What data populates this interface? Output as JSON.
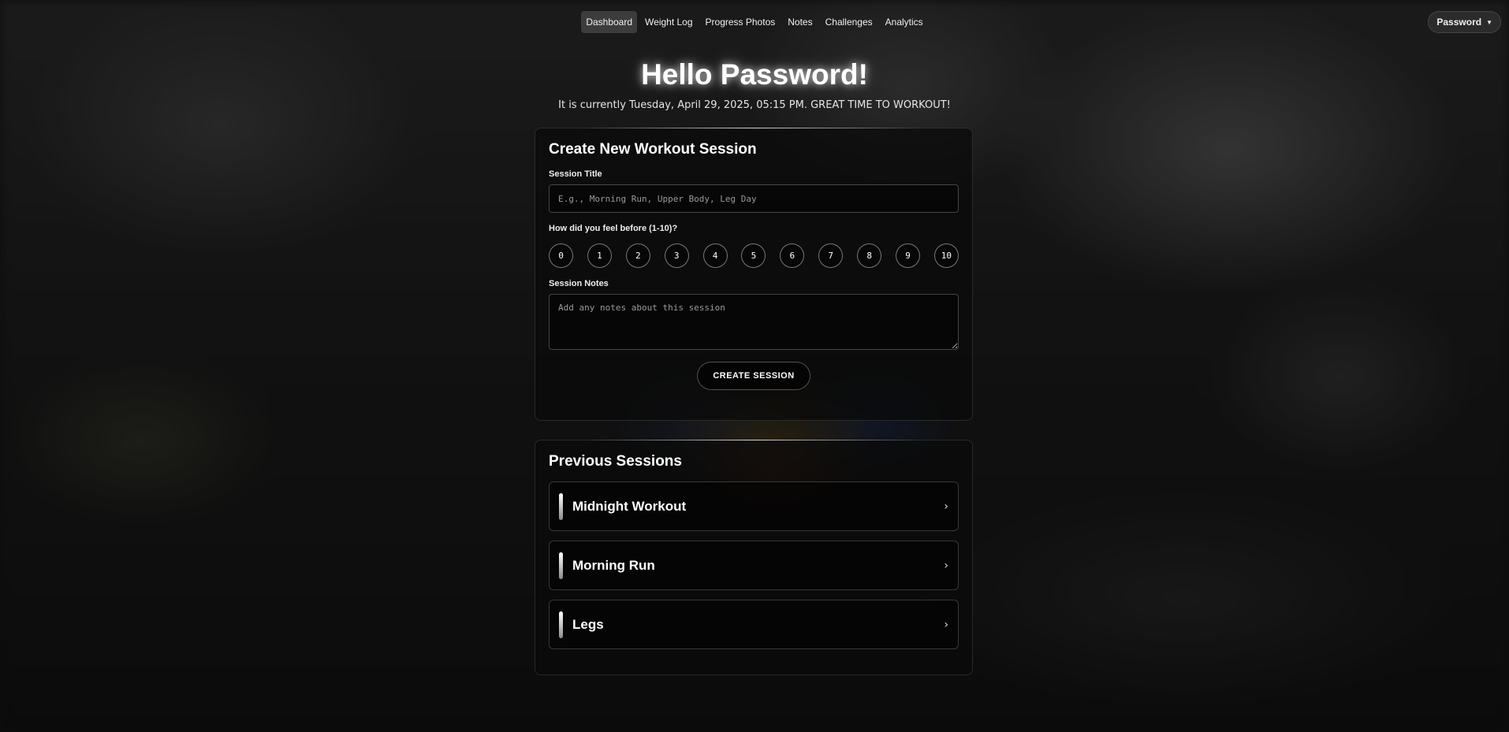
{
  "nav": {
    "links": [
      "Dashboard",
      "Weight Log",
      "Progress Photos",
      "Notes",
      "Challenges",
      "Analytics"
    ],
    "active": "Dashboard",
    "user_label": "Password"
  },
  "hero": {
    "greeting": "Hello Password!",
    "subtitle": "It is currently Tuesday, April 29, 2025, 05:15 PM. GREAT TIME TO WORKOUT!"
  },
  "create_session": {
    "title": "Create New Workout Session",
    "session_title_label": "Session Title",
    "session_title_placeholder": "E.g., Morning Run, Upper Body, Leg Day",
    "feel_label": "How did you feel before (1-10)?",
    "ratings": [
      "0",
      "1",
      "2",
      "3",
      "4",
      "5",
      "6",
      "7",
      "8",
      "9",
      "10"
    ],
    "notes_label": "Session Notes",
    "notes_placeholder": "Add any notes about this session",
    "button_label": "CREATE SESSION"
  },
  "previous_sessions": {
    "title": "Previous Sessions",
    "items": [
      "Midnight Workout",
      "Morning Run",
      "Legs"
    ]
  }
}
